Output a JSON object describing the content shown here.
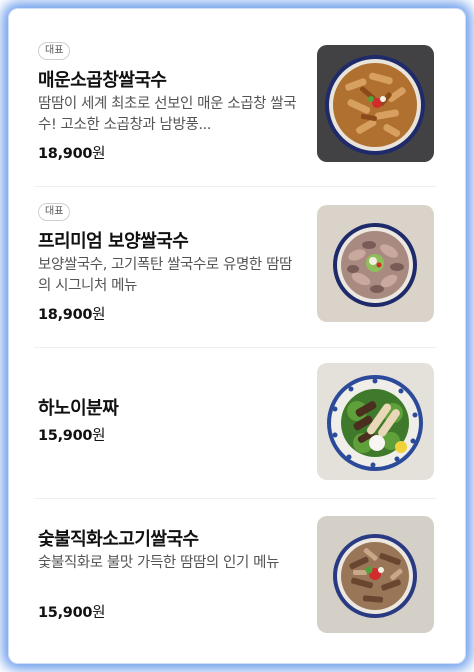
{
  "menu": {
    "items": [
      {
        "badge": "대표",
        "name": "매운소곱창쌀국수",
        "description": "땀땀이 세계 최초로 선보인 매운 소곱창 쌀국수! 고소한 소곱창과 남방풍...",
        "price": "18,900",
        "currency": "원",
        "image_icon": "spicy-beef-tripe-pho-photo"
      },
      {
        "badge": "대표",
        "name": "프리미엄 보양쌀국수",
        "description": "보양쌀국수, 고기폭탄 쌀국수로 유명한 땀땀의 시그니처 메뉴",
        "price": "18,900",
        "currency": "원",
        "image_icon": "premium-boyang-pho-photo"
      },
      {
        "name": "하노이분짜",
        "price": "15,900",
        "currency": "원",
        "image_icon": "hanoi-bun-cha-photo"
      },
      {
        "name": "숯불직화소고기쌀국수",
        "description": "숯불직화로 불맛 가득한 땀땀의 인기 메뉴",
        "price": "15,900",
        "currency": "원",
        "image_icon": "charcoal-grilled-beef-pho-photo"
      }
    ]
  },
  "colors": {
    "frame_glow": "#4080e6",
    "text_primary": "#111111",
    "text_secondary": "#555555",
    "divider": "#efefef"
  }
}
